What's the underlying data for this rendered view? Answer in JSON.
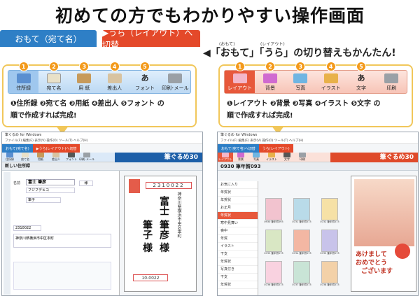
{
  "headline": "初めての方でもわかりやすい操作画面",
  "tabs": {
    "front": "おもて（宛て名）",
    "back": "▶うら（レイアウト）へ切替"
  },
  "switch_note": {
    "text": "◀「おもて」「うら」の切り替えもかんたん!",
    "ruby_omote": "(おもて)",
    "ruby_layout": "(レイアウト)"
  },
  "left_panel": {
    "items": [
      {
        "num": "1",
        "label": "住所録"
      },
      {
        "num": "2",
        "label": "宛て名"
      },
      {
        "num": "3",
        "label": "用 紙"
      },
      {
        "num": "4",
        "label": "差出人"
      },
      {
        "num": "5",
        "label": "フォント"
      },
      {
        "num": "",
        "label": "印刷･メール"
      }
    ],
    "desc_line1": "❶住所録 ❷宛て名 ❸用紙 ❹差出人 ❺フォント の",
    "desc_line2": "順で作成すれば完成!"
  },
  "right_panel": {
    "items": [
      {
        "num": "1",
        "label": "レイアウト"
      },
      {
        "num": "2",
        "label": "背景"
      },
      {
        "num": "3",
        "label": "写真"
      },
      {
        "num": "4",
        "label": "イラスト"
      },
      {
        "num": "5",
        "label": "文字"
      },
      {
        "num": "",
        "label": "印刷"
      }
    ],
    "desc_line1": "❶レイアウト ❷背景 ❸写真 ❹イラスト ❺文字 の",
    "desc_line2": "順で作成すれば完成!"
  },
  "left_window": {
    "title": "筆ぐるめ for Windows",
    "menu": "ファイル(F)  編集(E)  表示(V)  操作(O)  ツール(T)  ヘルプ(H)",
    "tab_front": "おもて(宛て名)",
    "tab_back": "▶うら(レイアウト)へ切替",
    "toolbar": [
      "住所録",
      "宛て名",
      "用紙",
      "差出人",
      "フォント",
      "印刷･メール"
    ],
    "brand": "筆ぐるめ30",
    "subtitle": "新しい住所録",
    "name_label": "名前",
    "name_value": "富士 筆彦",
    "postal": "2310022",
    "address_value": "神奈川県横浜市中区本町",
    "label_kana": "フジフデヒコ",
    "label_sama": "様",
    "label_name2": "筆子",
    "card_name1": "富士",
    "card_name2": "筆彦 様",
    "card_name3": "筆子 様",
    "card_postal": "10-0022"
  },
  "right_window": {
    "title": "筆ぐるめ for Windows",
    "menu": "ファイル(F)  編集(E)  表示(V)  操作(O)  ツール(T)  ヘルプ(H)",
    "tab_front": "おもて(宛て名)へ切替",
    "tab_back": "うら(レイアウト)",
    "toolbar": [
      "レイアウト",
      "背景",
      "写真",
      "イラスト",
      "文字",
      "印刷"
    ],
    "brand": "筆ぐるめ30",
    "subtitle": "0930 筆年賀093",
    "sidebar_items": [
      "お気に入り",
      "年賀状",
      "年賀状",
      "お正月",
      "年賀状",
      "寒中見舞い",
      "喪中",
      "年賀",
      "イラスト",
      "干支",
      "年賀状",
      "写真付き",
      "干支",
      "年賀状"
    ],
    "thumb_labels": [
      "0930 筆年賀093",
      "0731 筆年賀073",
      "0732 筆年賀073",
      "0733 筆年賀073",
      "0734 筆年賀073",
      "0735 筆年賀073",
      "0736 筆年賀073",
      "0737 筆年賀073",
      "0738 筆年賀073"
    ],
    "card_greeting1": "あけまして",
    "card_greeting2": "おめでとう",
    "card_greeting3": "ございます"
  },
  "colors": {
    "blue": "#2e7fc6",
    "red": "#e4492a",
    "orange": "#f39a1b",
    "gold": "#f1c75a"
  }
}
